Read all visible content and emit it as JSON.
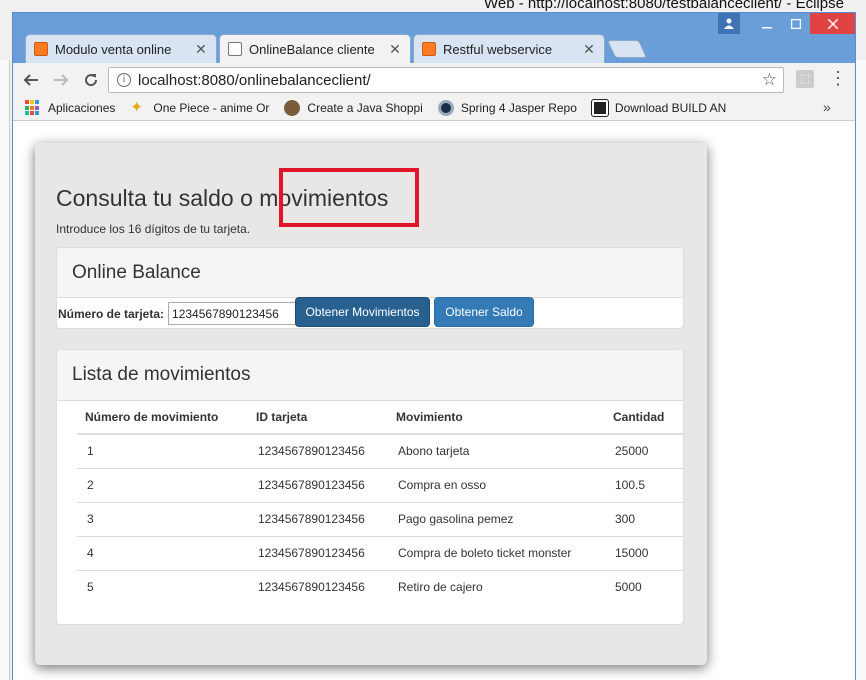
{
  "eclipse": {
    "title": "Web - http://localhost:8080/testbalanceclient/ - Eclipse"
  },
  "browser": {
    "tabs": [
      {
        "label": "Modulo venta online",
        "favicon": "xampp-icon"
      },
      {
        "label": "OnlineBalance cliente",
        "favicon": "page-icon"
      },
      {
        "label": "Restful webservice",
        "favicon": "xampp-icon"
      }
    ],
    "active_tab": 1,
    "url": "localhost:8080/onlinebalanceclient/",
    "bookmarks": [
      {
        "label": "Aplicaciones",
        "icon": "apps-grid-icon"
      },
      {
        "label": "One Piece - anime Or",
        "icon": "star-icon"
      },
      {
        "label": "Create a Java Shoppi",
        "icon": "bookmark-icon"
      },
      {
        "label": "Spring 4 Jasper Repo",
        "icon": "bookmark-icon"
      },
      {
        "label": "Download BUILD AN",
        "icon": "bookmark-icon"
      }
    ],
    "bookmarks_more": "»"
  },
  "page": {
    "title": "Consulta tu saldo o movimientos",
    "subtitle": "Introduce los 16 dígitos de tu tarjeta.",
    "balance_panel": {
      "heading": "Online Balance",
      "card_label": "Número de tarjeta:",
      "card_value": "1234567890123456",
      "btn_movimientos": "Obtener Movimientos",
      "btn_saldo": "Obtener Saldo"
    },
    "list_panel": {
      "heading": "Lista de movimientos",
      "columns": [
        "Número de movimiento",
        "ID tarjeta",
        "Movimiento",
        "Cantidad"
      ],
      "rows": [
        [
          "1",
          "1234567890123456",
          "Abono tarjeta",
          "25000"
        ],
        [
          "2",
          "1234567890123456",
          "Compra en osso",
          "100.5"
        ],
        [
          "3",
          "1234567890123456",
          "Pago gasolina pemez",
          "300"
        ],
        [
          "4",
          "1234567890123456",
          "Compra de boleto ticket monster",
          "15000"
        ],
        [
          "5",
          "1234567890123456",
          "Retiro de cajero",
          "5000"
        ]
      ]
    }
  },
  "colors": {
    "primary_button": "#337ab7",
    "active_button": "#286090",
    "highlight_box": "#e0152c",
    "jumbotron": "#e9e7e5"
  }
}
